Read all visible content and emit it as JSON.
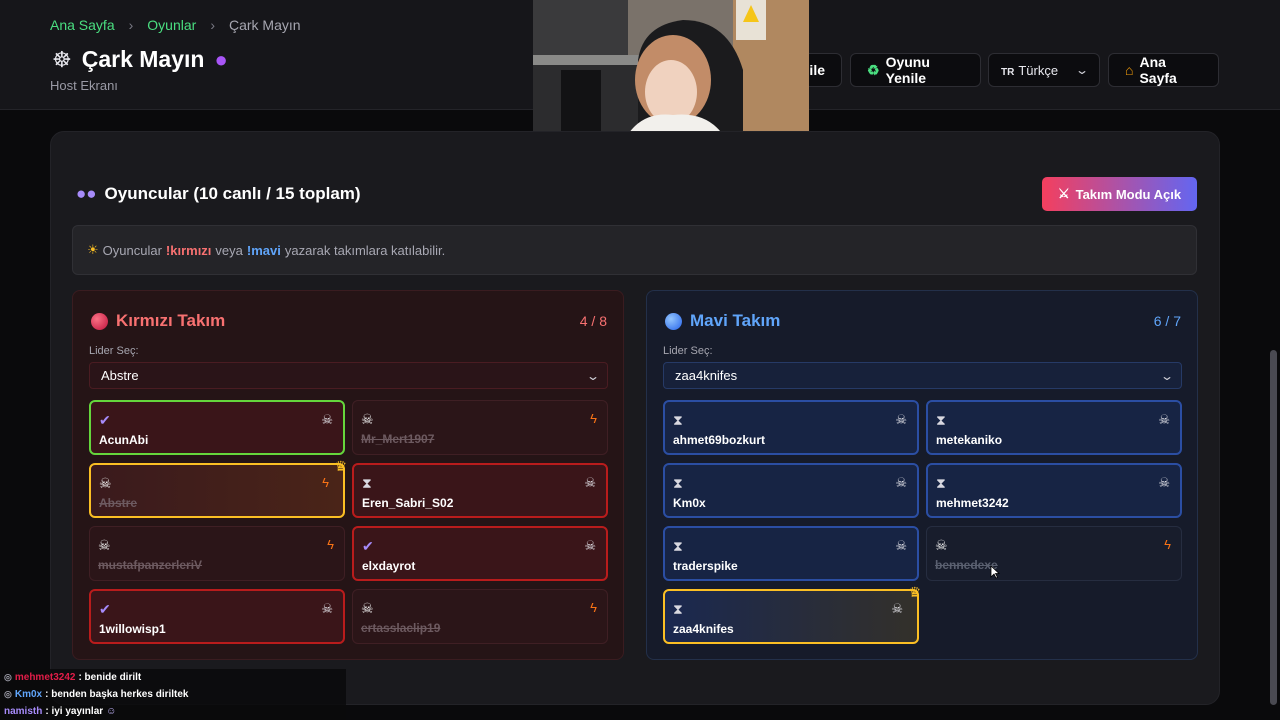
{
  "breadcrumb": {
    "home": "Ana Sayfa",
    "games": "Oyunlar",
    "current": "Çark Mayın"
  },
  "header": {
    "title": "Çark Mayın",
    "subtitle": "Host Ekranı"
  },
  "toolbar": {
    "cut_button_label": "nile",
    "restart_label": "Oyunu Yenile",
    "language_flag": "TR",
    "language_label": "Türkçe",
    "home_label": "Ana Sayfa"
  },
  "players": {
    "title": "Oyuncular (10 canlı / 15 toplam)",
    "team_mode_label": "Takım Modu Açık"
  },
  "info": {
    "before": "Oyuncular",
    "red_cmd": "!kırmızı",
    "middle": "veya",
    "blue_cmd": "!mavi",
    "after": "yazarak takımlara katılabilir."
  },
  "red_team": {
    "name": "Kırmızı Takım",
    "count": "4 / 8",
    "leader_label": "Lider Seç:",
    "leader_value": "Abstre",
    "players": [
      "AcunAbi",
      "Mr_Mert1907",
      "Abstre",
      "Eren_Sabri_S02",
      "mustafpanzerleriV",
      "elxdayrot",
      "1willowisp1",
      "ertasslaclip19"
    ]
  },
  "blue_team": {
    "name": "Mavi Takım",
    "count": "6 / 7",
    "leader_label": "Lider Seç:",
    "leader_value": "zaa4knifes",
    "players": [
      "ahmet69bozkurt",
      "metekaniko",
      "Km0x",
      "mehmet3242",
      "traderspike",
      "bennedexe",
      "zaa4knifes"
    ]
  },
  "chat": [
    {
      "user": "mehmet3242",
      "text": ": benide dirilt"
    },
    {
      "user": "Km0x",
      "text": ": benden başka herkes diriltek"
    },
    {
      "user": "namisth",
      "text": ": iyi yayınlar"
    }
  ],
  "colors": {
    "green_link": "#4ade80",
    "red_team": "#f87171",
    "blue_team": "#60a5fa",
    "leader_gold": "#fbbf24"
  },
  "icons": {
    "alive": "check-icon",
    "dead": "skull-icon",
    "waiting": "hourglass-icon",
    "kill": "crossbones-icon",
    "revive": "bolt-icon",
    "leader": "crown-icon"
  }
}
